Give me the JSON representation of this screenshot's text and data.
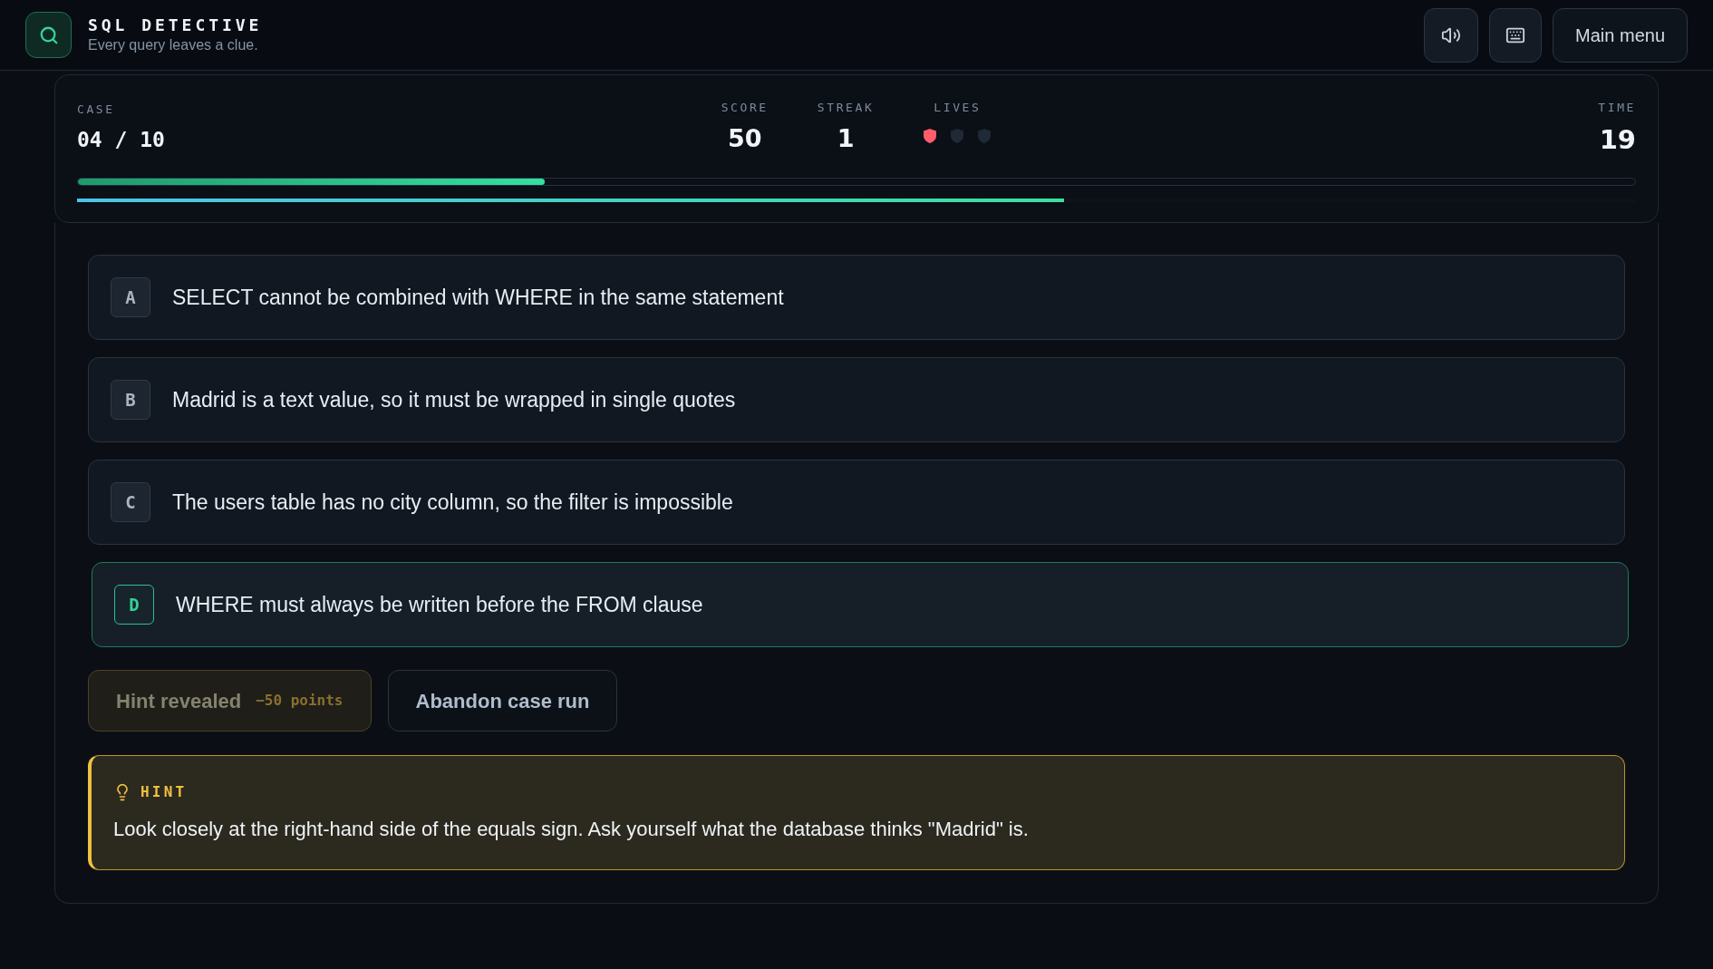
{
  "app": {
    "title": "SQL DETECTIVE",
    "tagline": "Every query leaves a clue."
  },
  "header_buttons": [
    {
      "kind": "sound"
    },
    {
      "kind": "keyboard"
    },
    {
      "kind": "text",
      "label": "Main menu"
    }
  ],
  "stats": {
    "case_label": "CASE",
    "case_value": "04 / 10",
    "score_label": "SCORE",
    "score_value": "50",
    "streak_label": "STREAK",
    "streak_value": "1",
    "lives_label": "LIVES",
    "lives": [
      {
        "filled": true
      },
      {
        "filled": false
      },
      {
        "filled": false
      }
    ],
    "time_label": "TIME",
    "time_value": "19",
    "case_progress": {
      "level": 0.3
    },
    "timer": {
      "level": 0.633
    }
  },
  "options": [
    {
      "letter": "A",
      "text": "SELECT cannot be combined with WHERE in the same statement",
      "selected": false
    },
    {
      "letter": "B",
      "text": "Madrid is a text value, so it must be wrapped in single quotes",
      "selected": false
    },
    {
      "letter": "C",
      "text": "The users table has no city column, so the filter is impossible",
      "selected": false
    },
    {
      "letter": "D",
      "text": "WHERE must always be written before the FROM clause",
      "selected": true
    }
  ],
  "actions": {
    "hint_button": {
      "label": "Hint revealed",
      "cost": "−50 points",
      "disabled": true
    },
    "abandon_button": {
      "label": "Abandon case run"
    }
  },
  "hint": {
    "title": "HINT",
    "text": "Look closely at the right-hand side of the equals sign. Ask yourself what the database thinks \"Madrid\" is."
  }
}
